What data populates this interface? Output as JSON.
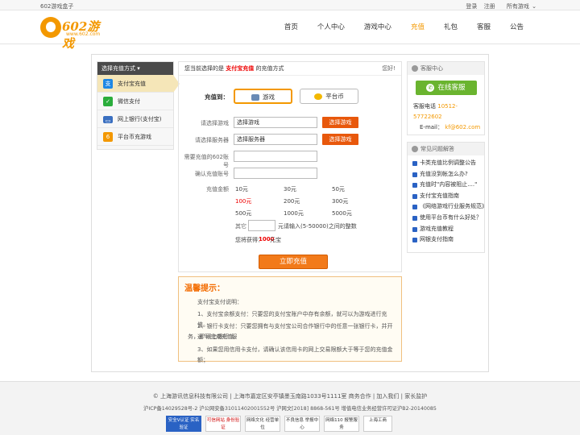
{
  "topbar": {
    "left": "602游戏盒子",
    "login": "登录",
    "register": "注册",
    "all_games": "所有游戏"
  },
  "logo": {
    "text": "602游戏",
    "url": "www.602.com"
  },
  "nav": [
    "首页",
    "个人中心",
    "游戏中心",
    "充值",
    "礼包",
    "客服",
    "公告"
  ],
  "sidebar": {
    "title": "选择充值方式",
    "items": [
      {
        "label": "支付宝充值",
        "icon": "alipay-icon",
        "color": "#1e88e5"
      },
      {
        "label": "微信支付",
        "icon": "wechat-icon",
        "color": "#2bad3c"
      },
      {
        "label": "网上银行(支付宝)",
        "icon": "bank-card-icon",
        "color": "#3a6fc0"
      },
      {
        "label": "平台币充游戏",
        "icon": "platform-coin-icon",
        "color": "#f39800"
      }
    ]
  },
  "center": {
    "notice_prefix": "您当前选择的是",
    "notice_method": "支付宝充值",
    "notice_suffix": "的充值方式",
    "help": "您好!",
    "recharge_to": "充值到：",
    "tab_game": "游戏",
    "tab_platform": "平台币",
    "game_label": "请选择游戏",
    "game_value": "选择游戏",
    "server_label": "请选择服务器",
    "server_value": "选择服务器",
    "select_btn_game": "选择游戏",
    "select_btn_server": "选择游戏",
    "account_label": "需要充值的602账号",
    "confirm_label": "确认充值账号",
    "amount_label": "充值金额",
    "amounts": [
      "10元",
      "30元",
      "50元",
      "100元",
      "200元",
      "300元",
      "500元",
      "1000元",
      "5000元"
    ],
    "other_label": "其它",
    "other_unit": "元",
    "other_hint": "请输入(5-50000)之间的整数",
    "get_prefix": "您将获得：",
    "get_value": "1000",
    "get_suffix": "元宝",
    "pay_button": "立即充值"
  },
  "tips": {
    "title": "温馨提示：",
    "lines": [
      "支付宝支付说明：",
      "1、支付宝余额支付：只要您的支付宝账户中存有余额，就可以为游戏进行充值。",
      "2、银行卡支付：只要您拥有与支付宝公司合作银行中的任意一张银行卡，并开通“网上银行”服",
      "务，即可完成充值。",
      "3、如果您用信用卡支付，请确认该信用卡的网上交易限额大于等于您的充值金额；"
    ]
  },
  "service": {
    "title": "客服中心",
    "button": "在线客服",
    "phone_label": "客服电话",
    "phone": "10512-57722602",
    "email_label": "E-mail：",
    "email": "kf@602.com"
  },
  "faq": {
    "title": "常见问题解答",
    "items": [
      "卡类充值比例调整公告",
      "充值没到帐怎么办?",
      "充值时\"内容被阻止....\"",
      "支付宝充值指南",
      "《网络游戏行业服务规范》",
      "使用平台币有什么好处？",
      "游戏充值教程",
      "网银支付指南"
    ]
  },
  "footer": {
    "line1": "© 上海游讯信息科技有限公司 | 上海市嘉定区安亭镇墨玉南路1033号1111室    商务合作 | 加入我们 | 家长监护",
    "line2": "沪ICP备14029528号-2 沪公网安备31011402001552号 沪网文[2018] 8868-561号 增值电信业务经营许可证沪B2-20140085",
    "badges": [
      "安全V认证 实名验证",
      "可信网站 身份验证",
      "网络文化 经营单位",
      "不良信息 举报中心",
      "网络110 报警服务",
      "上海工商"
    ]
  }
}
